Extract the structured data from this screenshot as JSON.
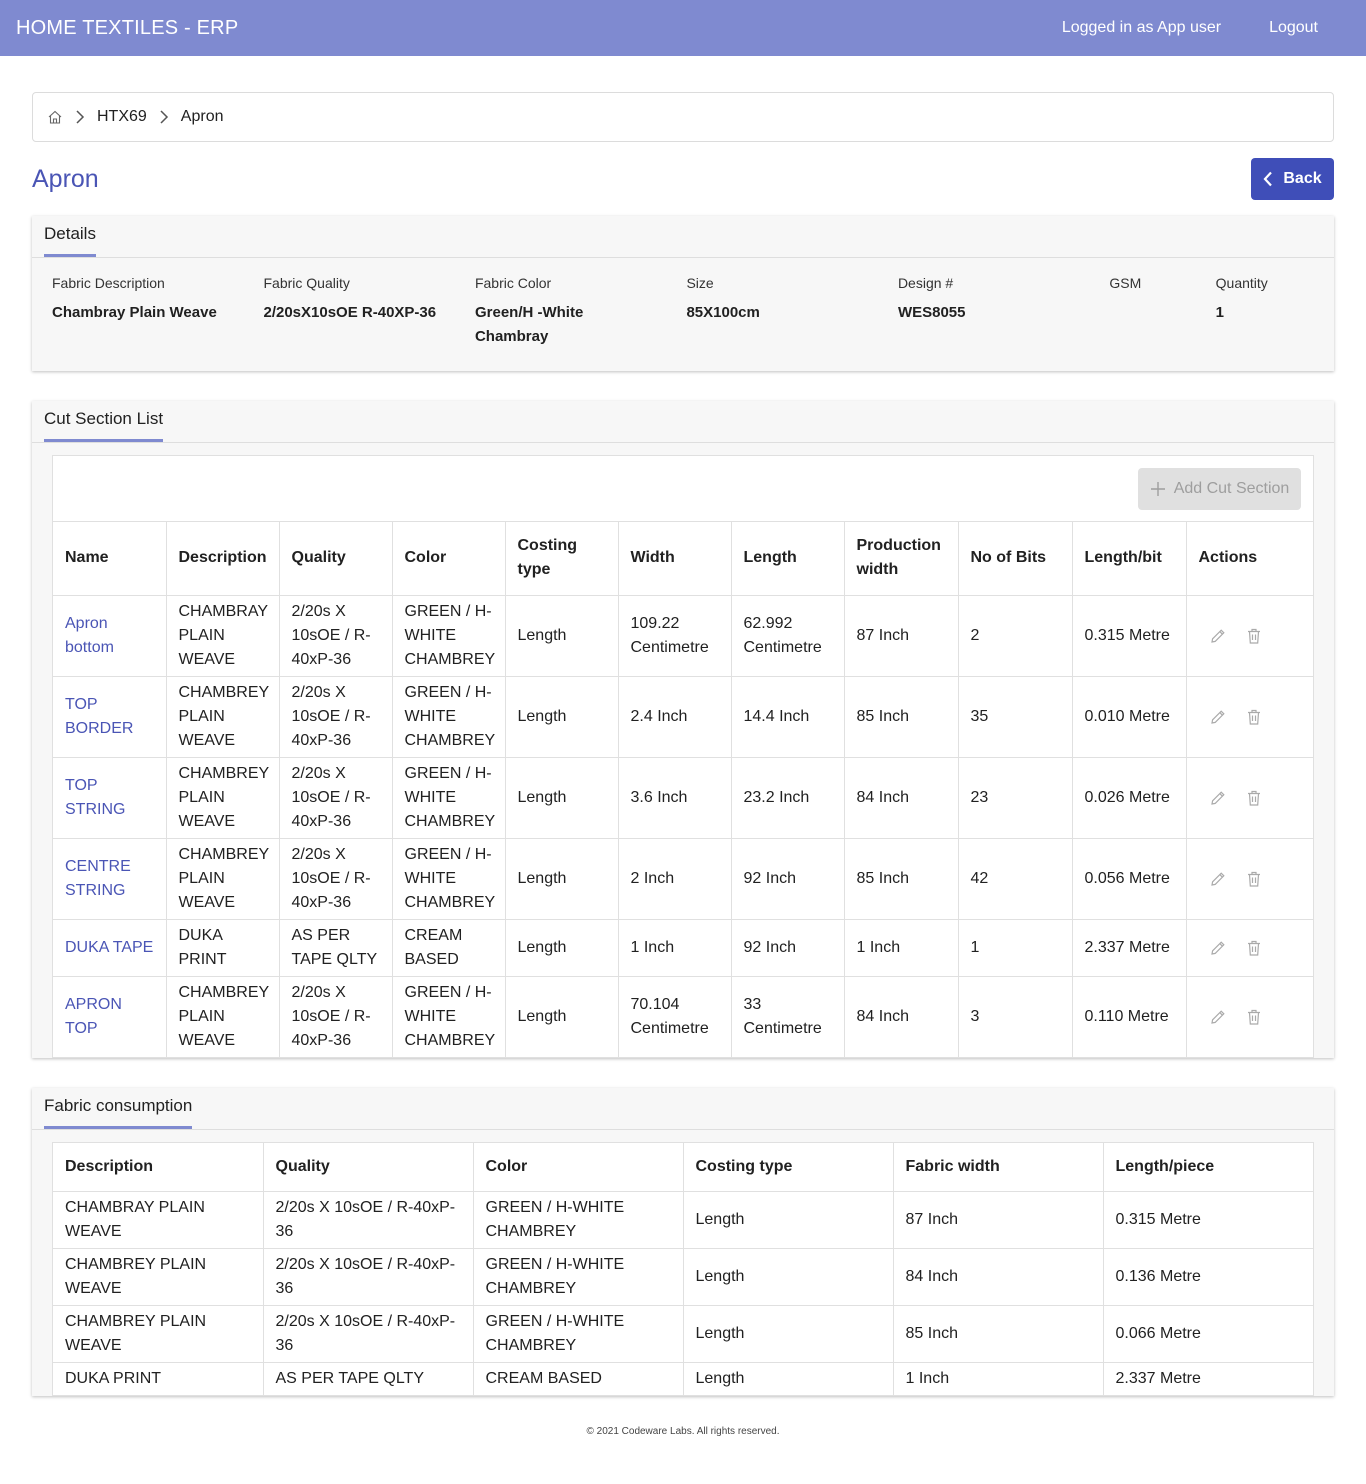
{
  "app": {
    "title": "HOME TEXTILES - ERP",
    "user_label": "Logged in as App user",
    "logout_label": "Logout"
  },
  "breadcrumb": {
    "home_icon": "home-icon",
    "items": [
      "HTX69",
      "Apron"
    ]
  },
  "page": {
    "title": "Apron",
    "back_label": "Back"
  },
  "details": {
    "tab_label": "Details",
    "fields": [
      {
        "label": "Fabric Description",
        "value": "Chambray Plain Weave"
      },
      {
        "label": "Fabric Quality",
        "value": "2/20sX10sOE R-40XP-36"
      },
      {
        "label": "Fabric Color",
        "value": "Green/H -White Chambray"
      },
      {
        "label": "Size",
        "value": "85X100cm"
      },
      {
        "label": "Design #",
        "value": "WES8055"
      },
      {
        "label": "GSM",
        "value": ""
      },
      {
        "label": "Quantity",
        "value": "1"
      }
    ]
  },
  "cut_section": {
    "tab_label": "Cut Section List",
    "add_label": "Add Cut Section",
    "headers": [
      "Name",
      "Description",
      "Quality",
      "Color",
      "Costing type",
      "Width",
      "Length",
      "Production width",
      "No of Bits",
      "Length/bit",
      "Actions"
    ],
    "rows": [
      {
        "name": "Apron bottom",
        "description": "CHAMBRAY PLAIN WEAVE",
        "quality": "2/20s X 10sOE / R-40xP-36",
        "color": "GREEN / H-WHITE CHAMBREY",
        "costing": "Length",
        "width": "109.22 Centimetre",
        "length": "62.992 Centimetre",
        "prod_width": "87 Inch",
        "bits": "2",
        "length_bit": "0.315 Metre"
      },
      {
        "name": "TOP BORDER",
        "description": "CHAMBREY PLAIN WEAVE",
        "quality": "2/20s X 10sOE / R-40xP-36",
        "color": "GREEN / H-WHITE CHAMBREY",
        "costing": "Length",
        "width": "2.4 Inch",
        "length": "14.4 Inch",
        "prod_width": "85 Inch",
        "bits": "35",
        "length_bit": "0.010 Metre"
      },
      {
        "name": "TOP STRING",
        "description": "CHAMBREY PLAIN WEAVE",
        "quality": "2/20s X 10sOE / R-40xP-36",
        "color": "GREEN / H-WHITE CHAMBREY",
        "costing": "Length",
        "width": "3.6 Inch",
        "length": "23.2 Inch",
        "prod_width": "84 Inch",
        "bits": "23",
        "length_bit": "0.026 Metre"
      },
      {
        "name": "CENTRE STRING",
        "description": "CHAMBREY PLAIN WEAVE",
        "quality": "2/20s X 10sOE / R-40xP-36",
        "color": "GREEN / H-WHITE CHAMBREY",
        "costing": "Length",
        "width": "2 Inch",
        "length": "92 Inch",
        "prod_width": "85 Inch",
        "bits": "42",
        "length_bit": "0.056 Metre"
      },
      {
        "name": "DUKA TAPE",
        "description": "DUKA PRINT",
        "quality": "AS PER TAPE QLTY",
        "color": "CREAM BASED",
        "costing": "Length",
        "width": "1 Inch",
        "length": "92 Inch",
        "prod_width": "1 Inch",
        "bits": "1",
        "length_bit": "2.337 Metre"
      },
      {
        "name": "APRON TOP",
        "description": "CHAMBREY PLAIN WEAVE",
        "quality": "2/20s X 10sOE / R-40xP-36",
        "color": "GREEN / H-WHITE CHAMBREY",
        "costing": "Length",
        "width": "70.104 Centimetre",
        "length": "33 Centimetre",
        "prod_width": "84 Inch",
        "bits": "3",
        "length_bit": "0.110 Metre"
      }
    ]
  },
  "fabric_consumption": {
    "tab_label": "Fabric consumption",
    "headers": [
      "Description",
      "Quality",
      "Color",
      "Costing type",
      "Fabric width",
      "Length/piece"
    ],
    "rows": [
      {
        "description": "CHAMBRAY PLAIN WEAVE",
        "quality": "2/20s X 10sOE / R-40xP-36",
        "color": "GREEN / H-WHITE CHAMBREY",
        "costing": "Length",
        "width": "87 Inch",
        "length": "0.315 Metre"
      },
      {
        "description": "CHAMBREY PLAIN WEAVE",
        "quality": "2/20s X 10sOE / R-40xP-36",
        "color": "GREEN / H-WHITE CHAMBREY",
        "costing": "Length",
        "width": "84 Inch",
        "length": "0.136 Metre"
      },
      {
        "description": "CHAMBREY PLAIN WEAVE",
        "quality": "2/20s X 10sOE / R-40xP-36",
        "color": "GREEN / H-WHITE CHAMBREY",
        "costing": "Length",
        "width": "85 Inch",
        "length": "0.066 Metre"
      },
      {
        "description": "DUKA PRINT",
        "quality": "AS PER TAPE QLTY",
        "color": "CREAM BASED",
        "costing": "Length",
        "width": "1 Inch",
        "length": "2.337 Metre"
      }
    ]
  },
  "footer": {
    "text": "© 2021 Codeware Labs. All rights reserved."
  },
  "colors": {
    "topbar": "#7f8ad0",
    "primary": "#3f4eb8",
    "link": "#4a55b5"
  }
}
